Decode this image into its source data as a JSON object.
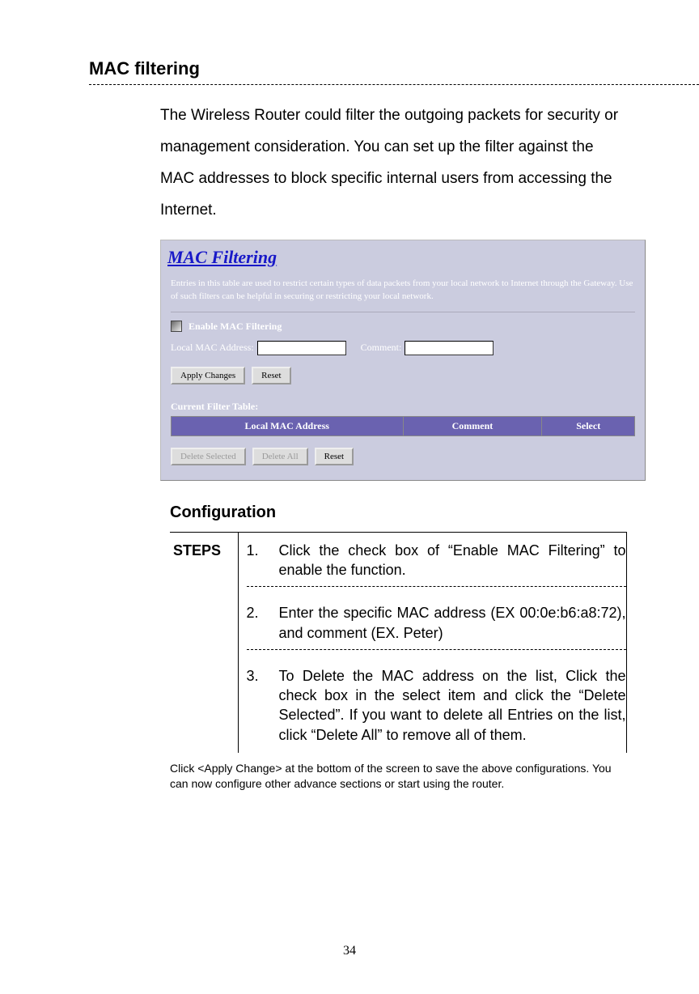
{
  "section_title": "MAC filtering",
  "intro": "The Wireless Router could filter the outgoing packets for security or management consideration. You can set up the filter against the MAC addresses to block specific internal users from accessing the Internet.",
  "router_panel": {
    "title": "MAC Filtering",
    "desc": "Entries in this table are used to restrict certain types of data packets from your local network to Internet through the Gateway. Use of such filters can be helpful in securing or restricting your local network.",
    "enable_label": "Enable MAC Filtering",
    "mac_label": "Local MAC Address:",
    "comment_label": "Comment:",
    "mac_value": "",
    "comment_value": "",
    "btn_apply": "Apply Changes",
    "btn_reset": "Reset",
    "table_caption": "Current Filter Table:",
    "col1": "Local MAC Address",
    "col2": "Comment",
    "col3": "Select",
    "btn_delete_selected": "Delete Selected",
    "btn_delete_all": "Delete All",
    "btn_reset2": "Reset"
  },
  "config_heading": "Configuration",
  "steps_label": "STEPS",
  "steps": {
    "n1": "1.",
    "t1": "Click the check box of “Enable MAC Filtering” to enable the function.",
    "n2": "2.",
    "t2": "Enter the specific MAC address (EX 00:0e:b6:a8:72), and comment (EX. Peter)",
    "n3": "3.",
    "t3": "To Delete the MAC address on the list, Click the check box in the select item and click the “Delete Selected”. If you want to delete all Entries on the list, click “Delete All” to remove all of them."
  },
  "footer_note": "Click <Apply Change> at the bottom of the screen to save the above configurations. You can now configure other advance sections or start using the router.",
  "page_number": "34"
}
